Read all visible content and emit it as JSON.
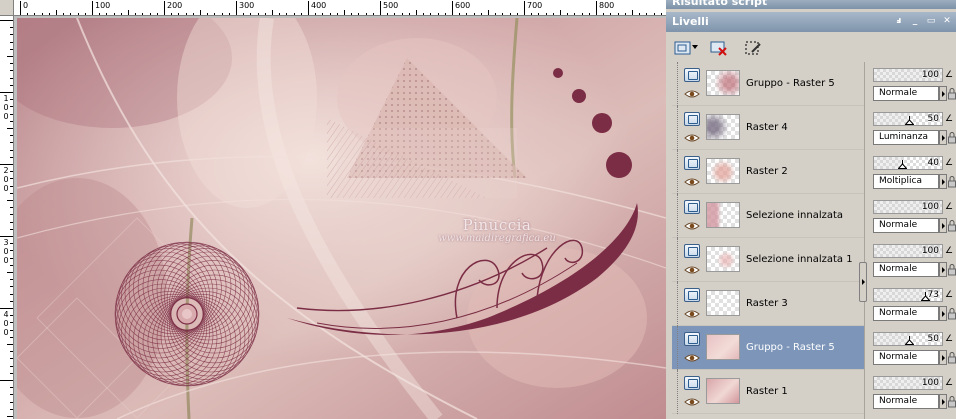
{
  "panels": {
    "script_title": "Risultato script",
    "layers_title": "Livelli"
  },
  "ruler": {
    "h_labels": [
      "0",
      "100",
      "200",
      "300",
      "400",
      "500",
      "600",
      "700",
      "800"
    ],
    "v_labels": [
      "1 0 0",
      "2 0 0",
      "3 0 0",
      "4 0 0"
    ]
  },
  "watermark": {
    "name": "Pinuccia",
    "url": "www.maidiregrafica.eu"
  },
  "layers": [
    {
      "name": "Gruppo - Raster 5",
      "opacity": 100,
      "blend": "Normale",
      "selected": false
    },
    {
      "name": "Raster 4",
      "opacity": 50,
      "blend": "Luminanza",
      "selected": false
    },
    {
      "name": "Raster 2",
      "opacity": 40,
      "blend": "Moltiplica",
      "selected": false
    },
    {
      "name": "Selezione innalzata",
      "opacity": 100,
      "blend": "Normale",
      "selected": false
    },
    {
      "name": "Selezione innalzata 1",
      "opacity": 100,
      "blend": "Normale",
      "selected": false
    },
    {
      "name": "Raster 3",
      "opacity": 73,
      "blend": "Normale",
      "selected": false
    },
    {
      "name": "Gruppo - Raster 5",
      "opacity": 50,
      "blend": "Normale",
      "selected": true
    },
    {
      "name": "Raster 1",
      "opacity": 100,
      "blend": "Normale",
      "selected": false
    }
  ],
  "colors": {
    "canvas_bg": "#c99a9d",
    "accent_dark": "#7b2d45",
    "selected_row": "#7c95b9",
    "title_bar": "#8fa3b8"
  },
  "icons": {
    "new_layer": "new-layer-icon",
    "delete_layer": "delete-layer-icon",
    "mask": "layer-mask-icon",
    "eye": "eye-icon",
    "lock": "lock-icon"
  }
}
